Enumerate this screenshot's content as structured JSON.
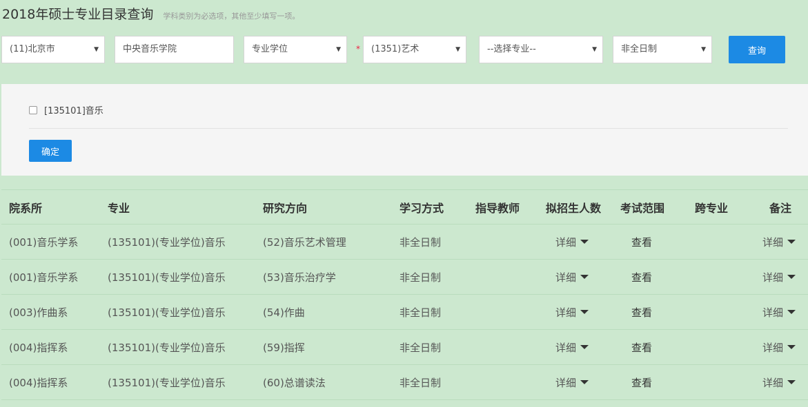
{
  "header": {
    "title": "2018年硕士专业目录查询",
    "subtitle": "学科类别为必选项，其他至少填写一项。"
  },
  "filters": {
    "province": "(11)北京市",
    "school": "中央音乐学院",
    "degree_type": "专业学位",
    "required_mark": "*",
    "discipline": "(1351)艺术",
    "major": "--选择专业--",
    "study_mode": "非全日制",
    "query_button": "查询"
  },
  "panel": {
    "checkbox_label": "[135101]音乐",
    "confirm_button": "确定"
  },
  "table": {
    "headers": [
      "院系所",
      "专业",
      "研究方向",
      "学习方式",
      "指导教师",
      "拟招生人数",
      "考试范围",
      "跨专业",
      "备注"
    ],
    "rows": [
      {
        "dept": "(001)音乐学系",
        "major": "(135101)(专业学位)音乐",
        "direction": "(52)音乐艺术管理",
        "mode": "非全日制",
        "quota": "详细",
        "exam": "查看",
        "note": "详细"
      },
      {
        "dept": "(001)音乐学系",
        "major": "(135101)(专业学位)音乐",
        "direction": "(53)音乐治疗学",
        "mode": "非全日制",
        "quota": "详细",
        "exam": "查看",
        "note": "详细"
      },
      {
        "dept": "(003)作曲系",
        "major": "(135101)(专业学位)音乐",
        "direction": "(54)作曲",
        "mode": "非全日制",
        "quota": "详细",
        "exam": "查看",
        "note": "详细"
      },
      {
        "dept": "(004)指挥系",
        "major": "(135101)(专业学位)音乐",
        "direction": "(59)指挥",
        "mode": "非全日制",
        "quota": "详细",
        "exam": "查看",
        "note": "详细"
      },
      {
        "dept": "(004)指挥系",
        "major": "(135101)(专业学位)音乐",
        "direction": "(60)总谱读法",
        "mode": "非全日制",
        "quota": "详细",
        "exam": "查看",
        "note": "详细"
      }
    ]
  },
  "colors": {
    "background": "#cce8cf",
    "accent": "#1c8ae4",
    "panel": "#f5f5f5"
  }
}
